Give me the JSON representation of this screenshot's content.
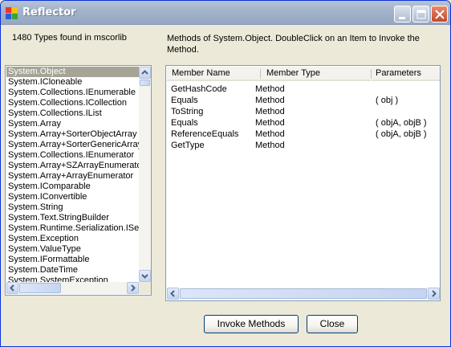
{
  "window": {
    "title": "Reflector"
  },
  "types_count_label": "1480 Types found in mscorlib",
  "methods_label": "Methods of System.Object.   DoubleClick on an Item to Invoke the Method.",
  "types": [
    "System.Object",
    "System.ICloneable",
    "System.Collections.IEnumerable",
    "System.Collections.ICollection",
    "System.Collections.IList",
    "System.Array",
    "System.Array+SorterObjectArray",
    "System.Array+SorterGenericArray",
    "System.Collections.IEnumerator",
    "System.Array+SZArrayEnumerator",
    "System.Array+ArrayEnumerator",
    "System.IComparable",
    "System.IConvertible",
    "System.String",
    "System.Text.StringBuilder",
    "System.Runtime.Serialization.ISerializable",
    "System.Exception",
    "System.ValueType",
    "System.IFormattable",
    "System.DateTime",
    "System.SystemException"
  ],
  "selected_type_index": 0,
  "columns": [
    "Member Name",
    "Member Type",
    "Parameters"
  ],
  "members": [
    {
      "name": "GetHashCode",
      "type": "Method",
      "params": ""
    },
    {
      "name": "Equals",
      "type": "Method",
      "params": "( obj )"
    },
    {
      "name": "ToString",
      "type": "Method",
      "params": ""
    },
    {
      "name": "Equals",
      "type": "Method",
      "params": "( objA, objB )"
    },
    {
      "name": "ReferenceEquals",
      "type": "Method",
      "params": "( objA, objB )"
    },
    {
      "name": "GetType",
      "type": "Method",
      "params": ""
    }
  ],
  "buttons": {
    "invoke": "Invoke Methods",
    "close": "Close"
  },
  "colors": {
    "selection": "#a6a496",
    "border": "#7f9db9"
  }
}
